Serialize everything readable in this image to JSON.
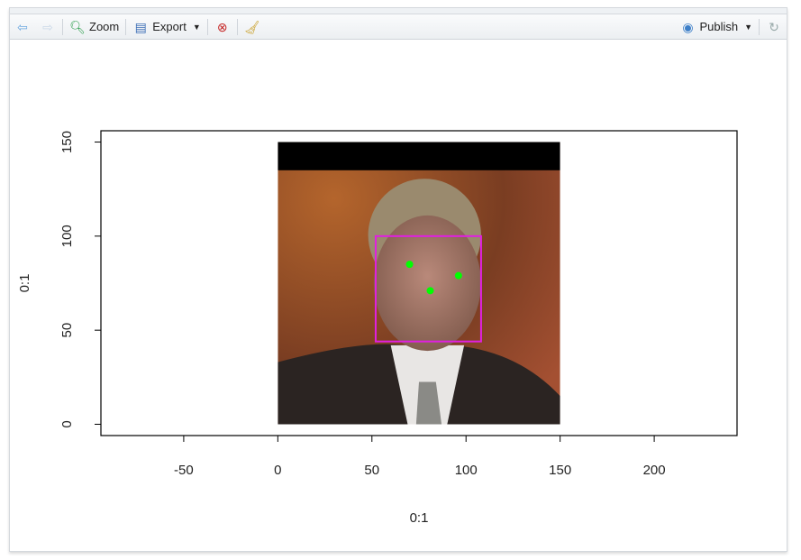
{
  "toolbar": {
    "back_icon": "arrow-left-icon",
    "forward_icon": "arrow-right-icon",
    "zoom_label": "Zoom",
    "export_label": "Export",
    "remove_icon": "remove-plot-icon",
    "clear_icon": "broom-icon",
    "publish_label": "Publish",
    "refresh_icon": "refresh-icon"
  },
  "chart_data": {
    "type": "scatter",
    "xlabel": "0:1",
    "ylabel": "0:1",
    "xlim": [
      -94,
      244
    ],
    "ylim": [
      -6,
      156
    ],
    "x_ticks": [
      -50,
      0,
      50,
      100,
      150,
      200
    ],
    "y_ticks": [
      0,
      50,
      100,
      150
    ],
    "grid": false,
    "raster_image": {
      "x": [
        0,
        150
      ],
      "y": [
        0,
        150
      ],
      "black_band_y": [
        135,
        150
      ],
      "description_icon": "face-photo"
    },
    "bounding_box": {
      "x": [
        52,
        108
      ],
      "y": [
        44,
        100
      ],
      "color": "#e020e0"
    },
    "points": {
      "x": [
        70,
        96,
        81
      ],
      "y": [
        85,
        79,
        71
      ],
      "color": "#00ff00"
    }
  }
}
